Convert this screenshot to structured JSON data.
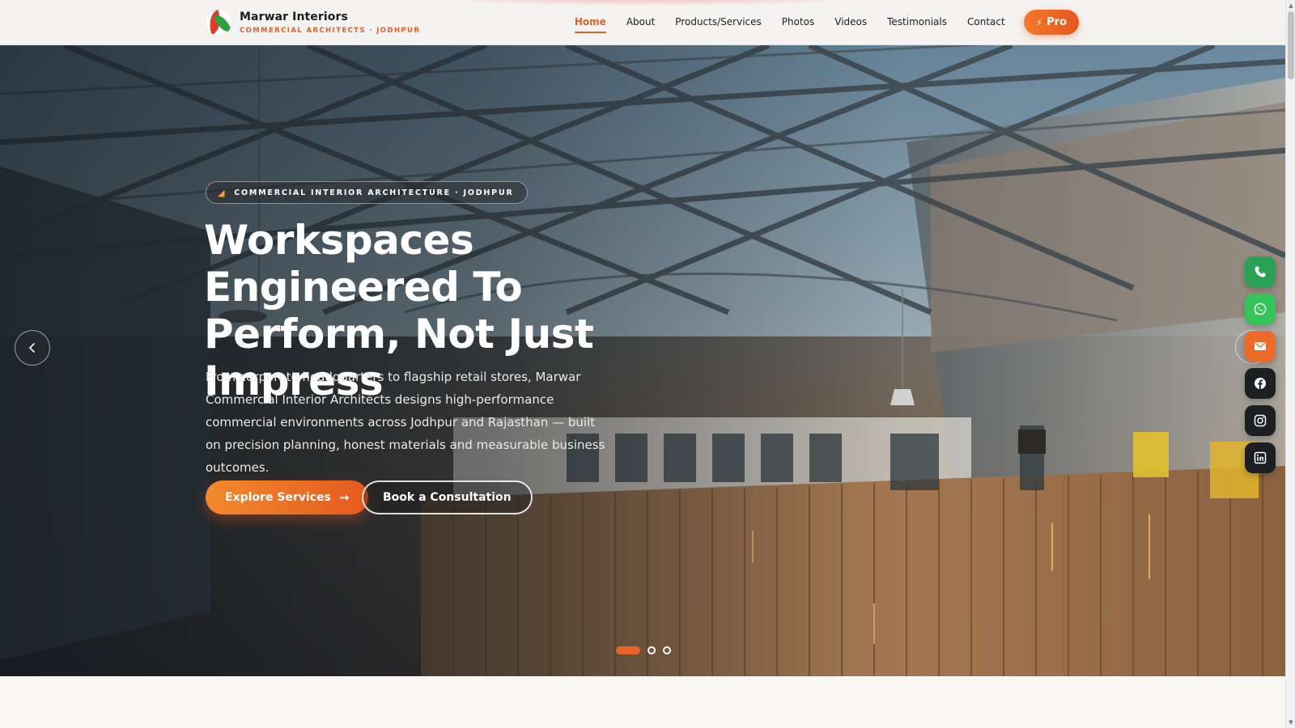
{
  "brand": {
    "name": "Marwar Interiors",
    "tagline": "COMMERCIAL ARCHITECTS · JODHPUR"
  },
  "nav": {
    "items": [
      {
        "label": "Home",
        "active": true
      },
      {
        "label": "About"
      },
      {
        "label": "Products/Services"
      },
      {
        "label": "Photos"
      },
      {
        "label": "Videos"
      },
      {
        "label": "Testimonials"
      },
      {
        "label": "Contact"
      }
    ],
    "pro_label": "Pro"
  },
  "hero": {
    "badge": "COMMERCIAL INTERIOR ARCHITECTURE · JODHPUR",
    "title": "Workspaces Engineered To Perform, Not Just Impress",
    "description": "From corporate headquarters to flagship retail stores, Marwar Commercial Interior Architects designs high-performance commercial environments across Jodhpur and Rajasthan — built on precision planning, honest materials and measurable business outcomes.",
    "primary_cta": "Explore Services",
    "secondary_cta": "Book a Consultation",
    "slides_total": 3,
    "active_slide": 1
  },
  "social": [
    {
      "icon": "phone-icon",
      "color": "#2aa153"
    },
    {
      "icon": "whatsapp-icon",
      "color": "#35c45a"
    },
    {
      "icon": "mail-icon",
      "color": "#ee6a2b"
    },
    {
      "icon": "facebook-icon",
      "color": "#1c1f22"
    },
    {
      "icon": "instagram-icon",
      "color": "#1c1f22"
    },
    {
      "icon": "linkedin-icon",
      "color": "#1c1f22"
    }
  ],
  "colors": {
    "accent": "#e2602a",
    "nav_bg": "#f5f3f1",
    "page_bg": "#faf7f3"
  }
}
